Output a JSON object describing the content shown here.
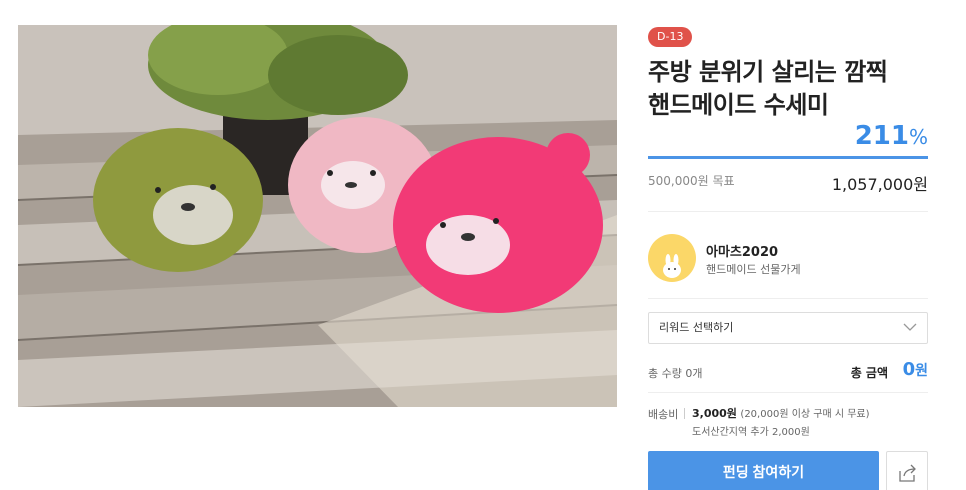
{
  "campaign": {
    "dday_badge": "D-13",
    "title_line1": "주방 분위기 살리는 깜찍",
    "title_line2": "핸드메이드 수세미",
    "achievement_percent": "211",
    "percent_sign": "%",
    "achievement_fraction": 2.11,
    "goal_text": "500,000원 목표",
    "raised_amount": "1,057,000원"
  },
  "maker": {
    "name": "아마츠2020",
    "description": "핸드메이드 선물가게"
  },
  "reward_select": {
    "selected": "리워드 선택하기"
  },
  "order": {
    "quantity_text": "총 수량  0개",
    "total_label": "총 금액",
    "total_number": "0",
    "total_unit": "원"
  },
  "shipping": {
    "label": "배송비",
    "fee": "3,000원",
    "condition": "(20,000원 이상 구매 시 무료)",
    "extra": "도서산간지역 추가 2,000원"
  },
  "actions": {
    "fund_label": "펀딩 참여하기",
    "share_icon": "share-icon"
  },
  "colors": {
    "accent": "#4b94e6",
    "badge": "#e0524a",
    "percent": "#3a8ce6"
  }
}
